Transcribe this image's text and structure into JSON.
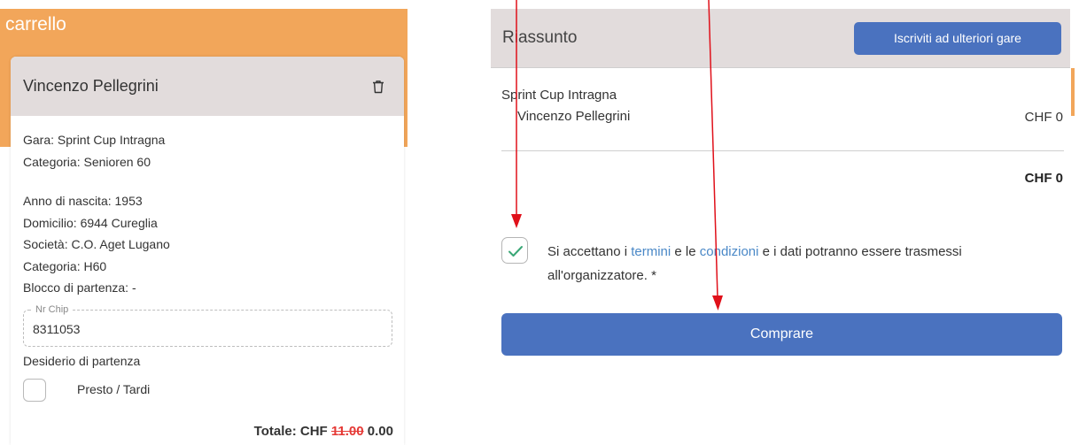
{
  "cart": {
    "title": "carrello",
    "entry": {
      "name": "Vincenzo Pellegrini",
      "gara": "Gara: Sprint Cup Intragna",
      "categoria_gara": "Categoria: Senioren 60",
      "anno": "Anno di nascita: 1953",
      "domicilio": "Domicilio: 6944 Cureglia",
      "societa": "Società: C.O. Aget Lugano",
      "categoria": "Categoria: H60",
      "blocco": "Blocco di partenza: -",
      "chip_label": "Nr Chip",
      "chip_value": "8311053",
      "wish_label": "Desiderio di partenza",
      "wish_option": "Presto / Tardi"
    },
    "total": {
      "prefix": "Totale: CHF",
      "old_price": "11.00",
      "new_price": "0.00"
    }
  },
  "summary": {
    "title": "Riassunto",
    "more_button": "Iscriviti ad ulteriori gare",
    "event": "Sprint Cup Intragna",
    "person": "Vincenzo Pellegrini",
    "price": "CHF 0",
    "total": "CHF 0",
    "terms": {
      "t1": "Si accettano i ",
      "link1": "termini",
      "t2": " e le ",
      "link2": "condizioni",
      "t3": " e i dati potranno essere trasmessi all'organizzatore. *",
      "checked": true
    },
    "buy_button": "Comprare"
  },
  "colors": {
    "orange": "#f2a65a",
    "header_grey": "#e2dcdc",
    "blue": "#4a72bf",
    "link": "#4a88c7",
    "strike_red": "#e53935",
    "check_green": "#3aa776",
    "arrow_red": "#e0101a"
  }
}
